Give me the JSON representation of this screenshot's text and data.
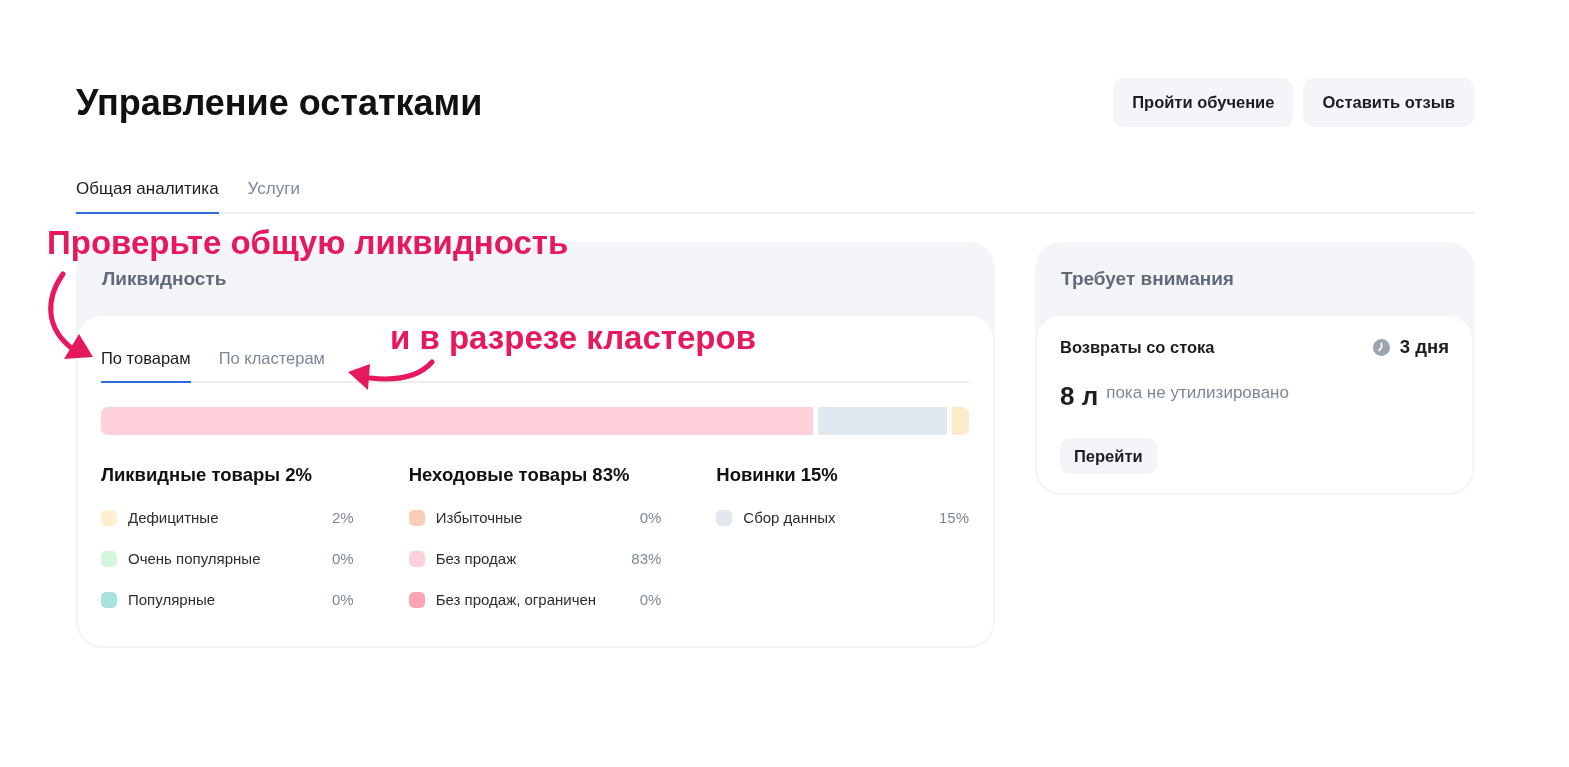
{
  "page": {
    "title": "Управление остатками"
  },
  "header_buttons": [
    "Пройти обучение",
    "Оставить отзыв"
  ],
  "tabs": [
    {
      "label": "Общая аналитика",
      "selected": true
    },
    {
      "label": "Услуги",
      "selected": false
    }
  ],
  "liquidity": {
    "title": "Ликвидность",
    "tabs": [
      {
        "label": "По товарам",
        "selected": true
      },
      {
        "label": "По кластерам",
        "selected": false
      }
    ],
    "distribution_bar": {
      "segments": [
        {
          "color": "#fdd0da"
        },
        {
          "color": "#e1e8ee"
        },
        {
          "color": "#fdeccb"
        }
      ]
    },
    "groups": [
      {
        "title": "Ликвидные товары 2%",
        "items": [
          {
            "label": "Дефицитные",
            "value": "2%",
            "color": "#fdefcf"
          },
          {
            "label": "Очень популярные",
            "value": "0%",
            "color": "#d6f6dc"
          },
          {
            "label": "Популярные",
            "value": "0%",
            "color": "#a6e3e0"
          }
        ]
      },
      {
        "title": "Неходовые товары 83%",
        "items": [
          {
            "label": "Избыточные",
            "value": "0%",
            "color": "#fbcdb6"
          },
          {
            "label": "Без продаж",
            "value": "83%",
            "color": "#fdd0da"
          },
          {
            "label": "Без продаж, ограничен",
            "value": "0%",
            "color": "#fca4b7"
          }
        ]
      },
      {
        "title": "Новинки 15%",
        "items": [
          {
            "label": "Сбор данных",
            "value": "15%",
            "color": "#e1e8ee"
          }
        ]
      }
    ]
  },
  "attention": {
    "title": "Требует внимания",
    "cards": [
      {
        "title": "Возвраты со стока",
        "deadline": "3 дня",
        "amount": "8 л",
        "note": "пока не утилизировано",
        "button": "Перейти"
      }
    ]
  },
  "annotations": [
    {
      "text": "Проверьте общую ликвидность"
    },
    {
      "text": "и в разрезе кластеров"
    }
  ]
}
